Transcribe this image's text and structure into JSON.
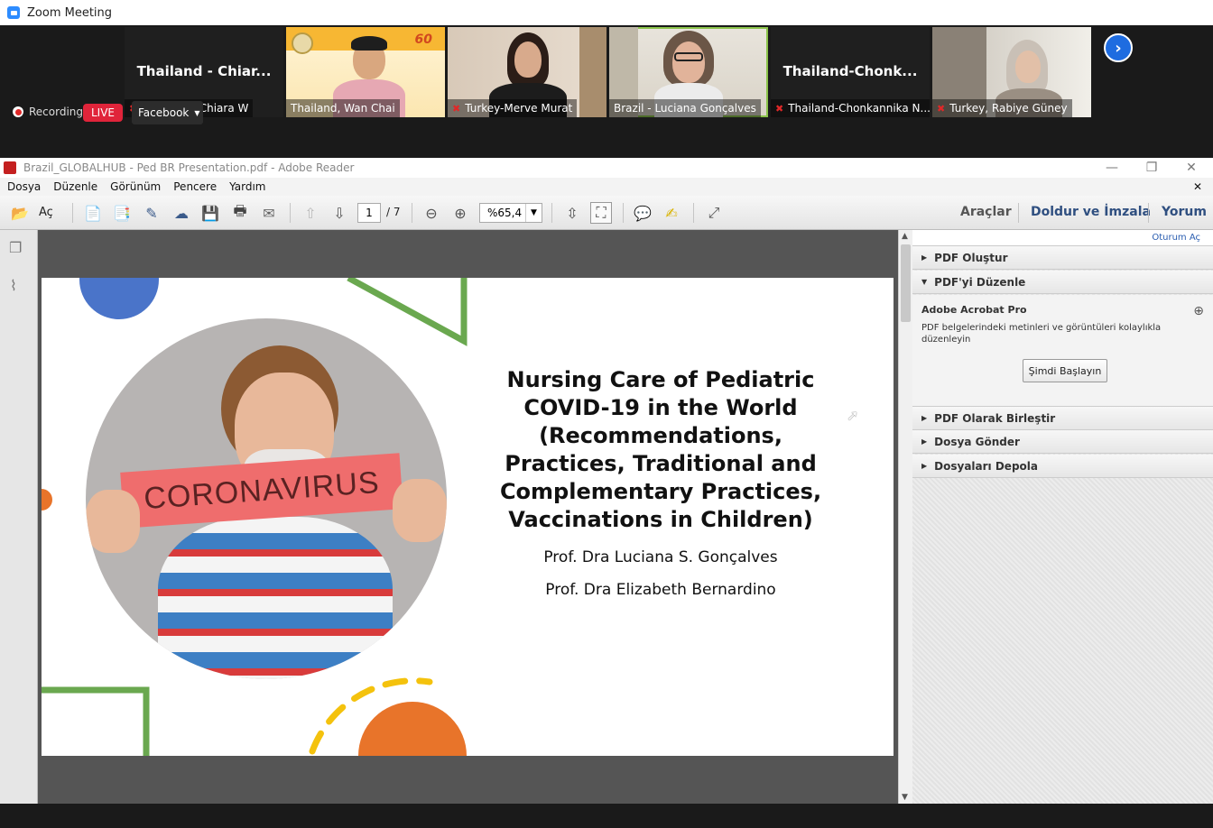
{
  "zoom": {
    "title": "Zoom Meeting",
    "participants": [
      {
        "name_big": "Thailand  -  Chiar...",
        "caption": "Thailand - Chiara W",
        "muted": true,
        "video": false
      },
      {
        "name_big": "",
        "caption": "Thailand, Wan Chai",
        "muted": false,
        "video": true
      },
      {
        "name_big": "",
        "caption": "Turkey-Merve Murat",
        "muted": true,
        "video": true
      },
      {
        "name_big": "",
        "caption": "Brazil - Luciana Gonçalves",
        "muted": false,
        "video": true,
        "active": true
      },
      {
        "name_big": "Thailand-Chonk...",
        "caption": "Thailand-Chonkannika N...",
        "muted": true,
        "video": false
      },
      {
        "name_big": "",
        "caption": "Turkey, Rabiye Güney",
        "muted": true,
        "video": true
      }
    ],
    "recording_label": "Recording",
    "live_label": "LIVE",
    "stream_label": "Facebook",
    "next_icon": "chevron-right-icon"
  },
  "reader": {
    "window_title": "Brazil_GLOBALHUB - Ped BR Presentation.pdf - Adobe Reader",
    "menu": [
      "Dosya",
      "Düzenle",
      "Görünüm",
      "Pencere",
      "Yardım"
    ],
    "open_label": "Aç",
    "page_current": "1",
    "page_total": "/ 7",
    "zoom_value": "%65,4",
    "right_links": [
      "Araçlar",
      "Doldur ve İmzala",
      "Yorum"
    ],
    "login_link": "Oturum Aç"
  },
  "slide": {
    "title_lines": [
      "Nursing Care of Pediatric",
      "COVID-19 in the World",
      "(Recommendations,",
      "Practices, Traditional and",
      "Complementary Practices,",
      "Vaccinations in Children)"
    ],
    "author1": "Prof. Dra Luciana S. Gonçalves",
    "author2": "Prof. Dra Elizabeth Bernardino",
    "sign_text": "CORONAVIRUS"
  },
  "panel": {
    "create_pdf": "PDF Oluştur",
    "edit_pdf": "PDF'yi Düzenle",
    "product": "Adobe Acrobat Pro",
    "description": "PDF belgelerindeki metinleri ve görüntüleri kolaylıkla düzenleyin",
    "start_button": "Şimdi Başlayın",
    "combine": "PDF Olarak Birleştir",
    "send": "Dosya Gönder",
    "store": "Dosyaları Depola"
  },
  "colors": {
    "accent_blue": "#1e6ce0",
    "live_red": "#e0243a",
    "slide_green": "#6aa84f",
    "slide_orange": "#e8742a",
    "slide_blue": "#4a74c9"
  }
}
